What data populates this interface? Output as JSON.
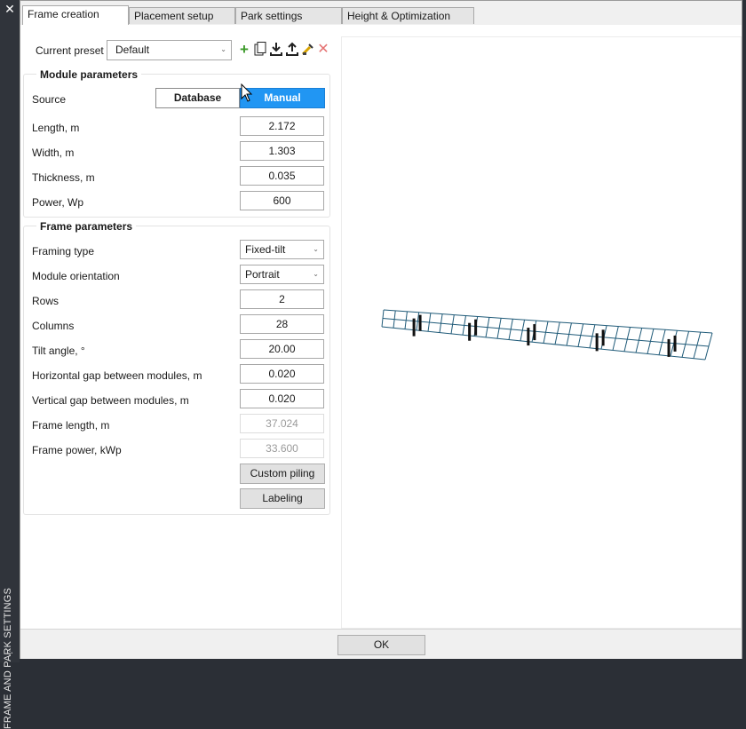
{
  "sidebar": {
    "title": "FRAME AND PARK SETTINGS",
    "close_glyph": "✕",
    "grip_glyph": "⁘"
  },
  "tabs": [
    {
      "label": "Frame creation",
      "active": true
    },
    {
      "label": "Placement setup",
      "active": false
    },
    {
      "label": "Park settings",
      "active": false
    },
    {
      "label": "Height & Optimization",
      "active": false
    }
  ],
  "preset": {
    "label": "Current preset",
    "value": "Default",
    "tools": [
      "add-icon",
      "copy-icon",
      "import-icon",
      "export-icon",
      "rename-icon",
      "delete-icon"
    ]
  },
  "module": {
    "title": "Module parameters",
    "source_label": "Source",
    "source_options": [
      "Database",
      "Manual"
    ],
    "source_selected": "Manual",
    "length_label": "Length, m",
    "length": "2.172",
    "width_label": "Width, m",
    "width": "1.303",
    "thickness_label": "Thickness, m",
    "thickness": "0.035",
    "power_label": "Power, Wp",
    "power": "600"
  },
  "frame": {
    "title": "Frame parameters",
    "framing_type_label": "Framing type",
    "framing_type": "Fixed-tilt",
    "orientation_label": "Module orientation",
    "orientation": "Portrait",
    "rows_label": "Rows",
    "rows": "2",
    "columns_label": "Columns",
    "columns": "28",
    "tilt_label": "Tilt angle, °",
    "tilt": "20.00",
    "hgap_label": "Horizontal gap between modules, m",
    "hgap": "0.020",
    "vgap_label": "Vertical gap between modules, m",
    "vgap": "0.020",
    "frame_length_label": "Frame length, m",
    "frame_length": "37.024",
    "frame_power_label": "Frame power, kWp",
    "frame_power": "33.600",
    "custom_piling": "Custom piling",
    "labeling": "Labeling"
  },
  "footer": {
    "ok": "OK"
  },
  "colors": {
    "accent": "#2196f3",
    "frame_grid": "#1f5a78",
    "pile": "#111111",
    "sidebar_bg": "#30343b"
  }
}
